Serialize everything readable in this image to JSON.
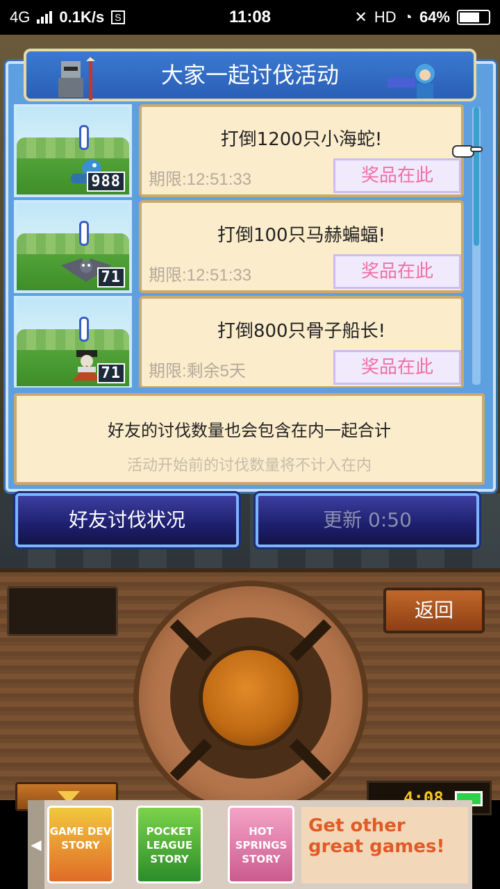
{
  "status_bar": {
    "network": "4G",
    "speed": "0.1K/s",
    "time": "11:08",
    "hd": "HD",
    "battery": "64%"
  },
  "dialog": {
    "title": "大家一起讨伐活动",
    "quests": [
      {
        "name": "打倒1200只小海蛇!",
        "deadline": "期限:12:51:33",
        "prize_label": "奖品在此",
        "kill_count": "988"
      },
      {
        "name": "打倒100只马赫蝙蝠!",
        "deadline": "期限:12:51:33",
        "prize_label": "奖品在此",
        "kill_count": "71"
      },
      {
        "name": "打倒800只骨子船长!",
        "deadline": "期限:剩余5天",
        "prize_label": "奖品在此",
        "kill_count": "71"
      }
    ],
    "note": {
      "line1": "好友的讨伐数量也会包含在内一起合计",
      "line2": "活动开始前的讨伐数量将不计入在内"
    },
    "buttons": {
      "friends_status": "好友讨伐状况",
      "refresh": "更新 0:50"
    }
  },
  "controller": {
    "back_label": "返回",
    "clock_time": "4:08"
  },
  "ad": {
    "game1": "GAME DEV STORY",
    "game2": "POCKET LEAGUE STORY",
    "game3": "HOT SPRINGS STORY",
    "cta_line1": "Get other",
    "cta_line2": "great games!"
  },
  "colors": {
    "dialog_blue": "#5e9fe0",
    "card_bg": "#fbeccb",
    "prize_text": "#ef6fa4",
    "button_navy": "#1d1f6d"
  }
}
